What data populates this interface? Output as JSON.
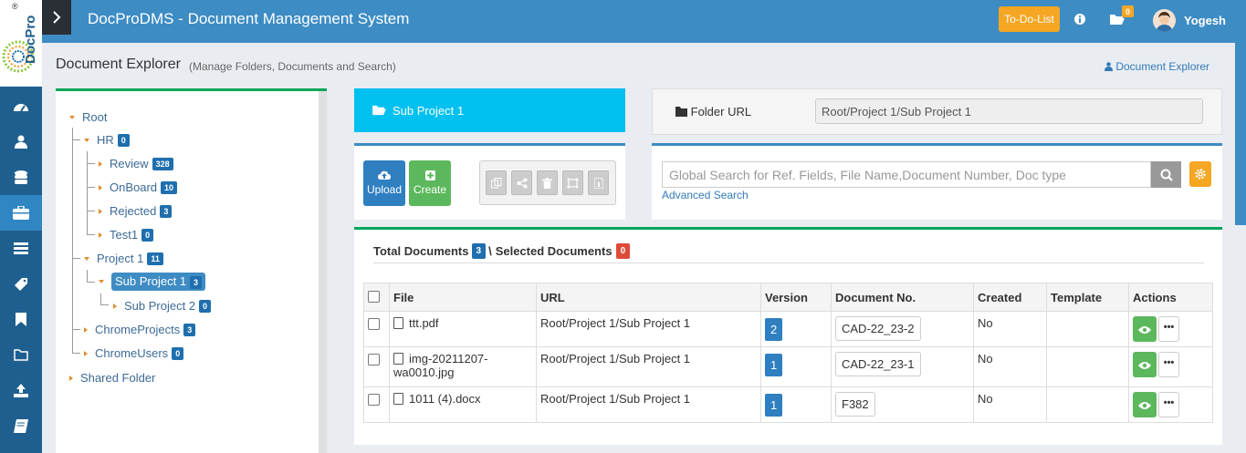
{
  "app": {
    "title": "DocProDMS - Document Management System",
    "logo_text": "DocPro",
    "todo_label": "To-Do-List",
    "notifications_count": "0",
    "user_name": "Yogesh"
  },
  "sidebar": {
    "items": [
      {
        "icon": "dashboard-icon"
      },
      {
        "icon": "user-icon"
      },
      {
        "icon": "database-icon"
      },
      {
        "icon": "briefcase-icon",
        "active": true
      },
      {
        "icon": "list-icon"
      },
      {
        "icon": "tag-icon"
      },
      {
        "icon": "bookmark-icon"
      },
      {
        "icon": "folder-icon"
      },
      {
        "icon": "upload-icon"
      },
      {
        "icon": "book-icon"
      }
    ]
  },
  "page": {
    "title": "Document Explorer",
    "subtitle": "(Manage Folders, Documents and Search)",
    "breadcrumb": "Document Explorer"
  },
  "tree": {
    "root": "Root",
    "hr": {
      "label": "HR",
      "count": "0"
    },
    "review": {
      "label": "Review",
      "count": "328"
    },
    "onboard": {
      "label": "OnBoard",
      "count": "10"
    },
    "rejected": {
      "label": "Rejected",
      "count": "3"
    },
    "test1": {
      "label": "Test1",
      "count": "0"
    },
    "project1": {
      "label": "Project 1",
      "count": "11"
    },
    "subproject1": {
      "label": "Sub Project 1",
      "count": "3"
    },
    "subproject2": {
      "label": "Sub Project 2",
      "count": "0"
    },
    "chromeprojects": {
      "label": "ChromeProjects",
      "count": "3"
    },
    "chromeusers": {
      "label": "ChromeUsers",
      "count": "0"
    },
    "shared": "Shared Folder"
  },
  "folder": {
    "current": "Sub Project 1",
    "url_label": "Folder URL",
    "url_value": "Root/Project 1/Sub Project 1"
  },
  "actions": {
    "upload": "Upload",
    "create": "Create"
  },
  "search": {
    "placeholder": "Global Search for Ref. Fields, File Name,Document Number, Doc type",
    "advanced": "Advanced Search"
  },
  "docs": {
    "total_label": "Total Documents",
    "total_count": "3",
    "separator": "\\",
    "selected_label": "Selected Documents",
    "selected_count": "0",
    "columns": [
      "File",
      "URL",
      "Version",
      "Document No.",
      "Created",
      "Template",
      "Actions"
    ],
    "rows": [
      {
        "file": "ttt.pdf",
        "type": "pdf",
        "url": "Root/Project 1/Sub Project 1",
        "version": "2",
        "docno": "CAD-22_23-2",
        "created": "No",
        "template": ""
      },
      {
        "file": "img-20211207-wa0010.jpg",
        "type": "image",
        "url": "Root/Project 1/Sub Project 1",
        "version": "1",
        "docno": "CAD-22_23-1",
        "created": "No",
        "template": ""
      },
      {
        "file": "1011 (4).docx",
        "type": "word",
        "url": "Root/Project 1/Sub Project 1",
        "version": "1",
        "docno": "F382",
        "created": "No",
        "template": ""
      }
    ]
  },
  "colors": {
    "topbar": "#3d8cc4",
    "sidebar": "#1f5f8f",
    "accent_green": "#00a65a",
    "accent_cyan": "#00c0ef",
    "todo_orange": "#f5a623"
  }
}
